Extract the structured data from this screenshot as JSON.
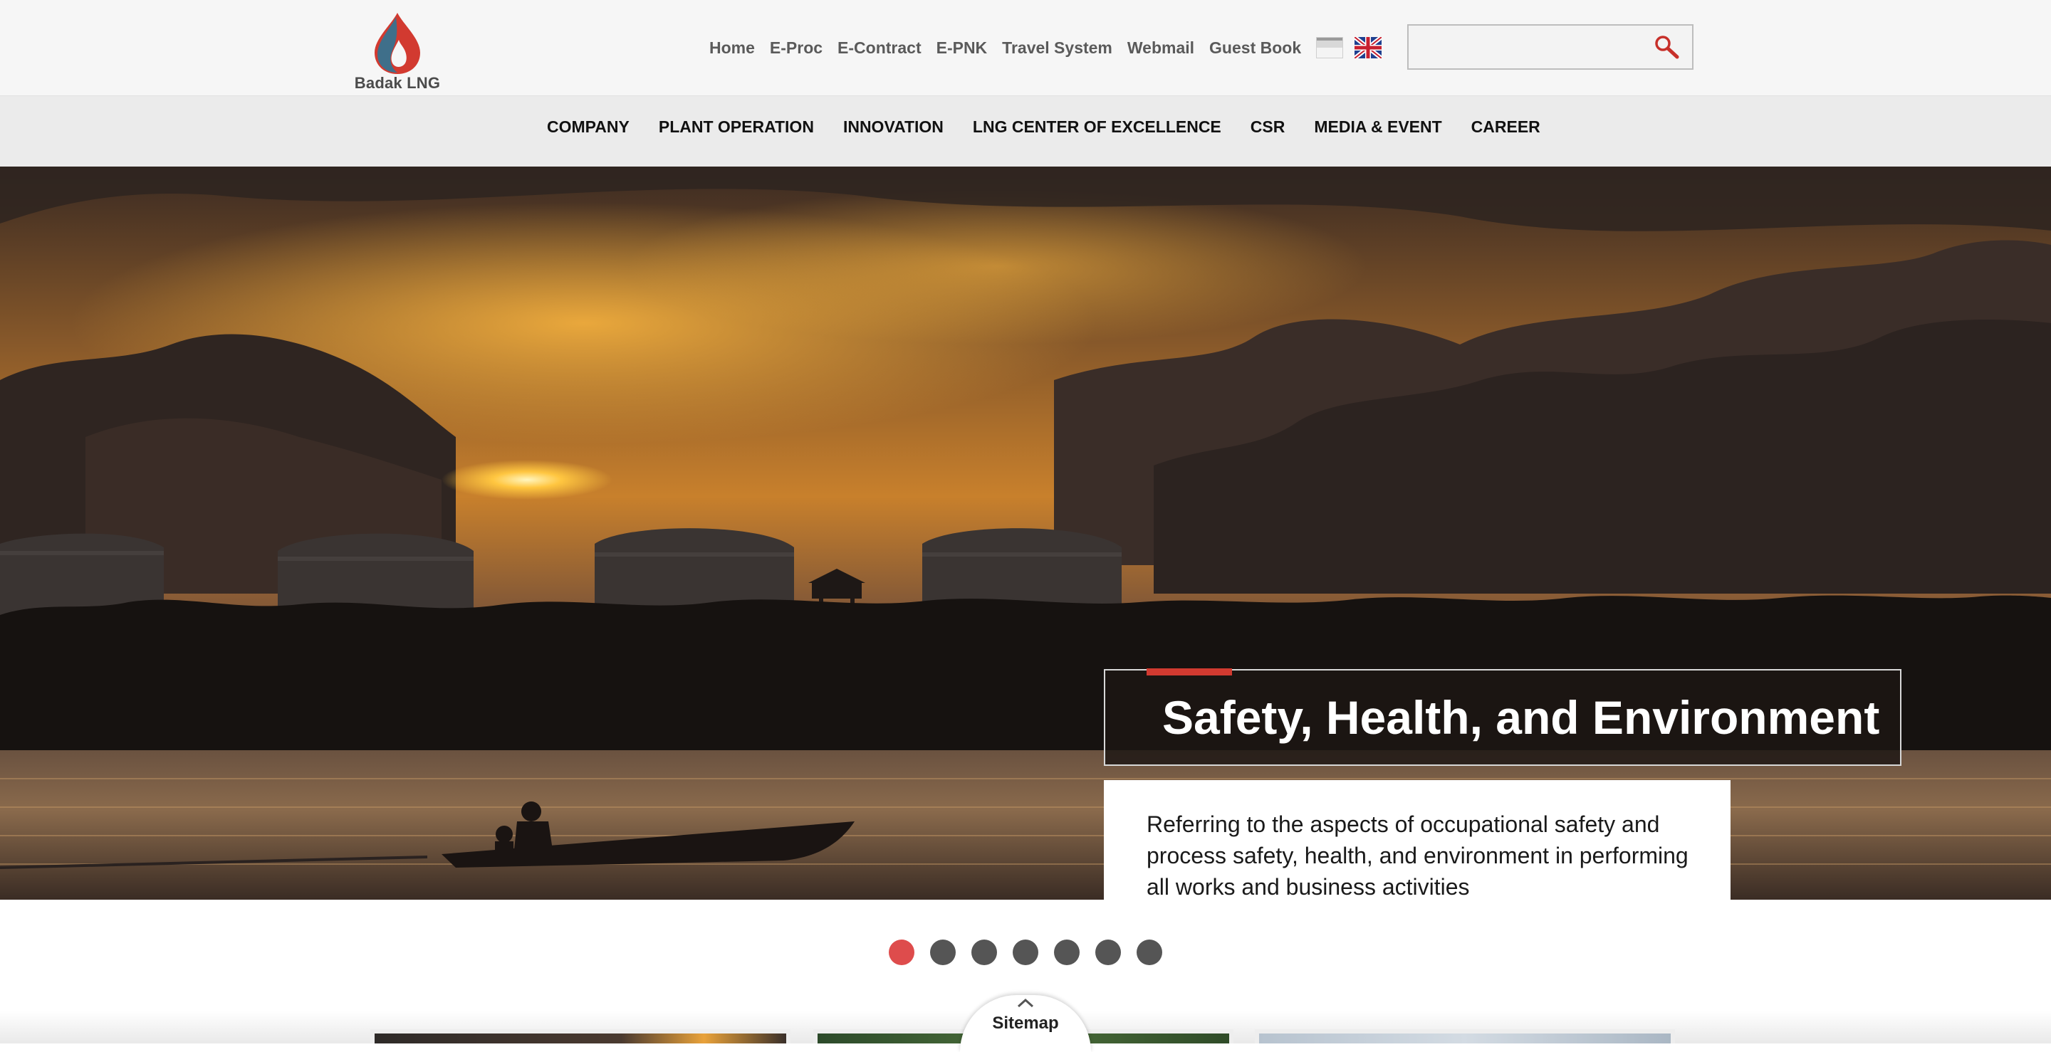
{
  "brand": {
    "logo_text": "Badak LNG",
    "colors": {
      "drop_blue": "#3f6f8a",
      "drop_red": "#d23a30",
      "accent_red": "#d23a30",
      "dot_active": "#de4c4c",
      "dot_inactive": "#555555"
    }
  },
  "utility_nav": [
    {
      "label": "Home"
    },
    {
      "label": "E-Proc"
    },
    {
      "label": "E-Contract"
    },
    {
      "label": "E-PNK"
    },
    {
      "label": "Travel System"
    },
    {
      "label": "Webmail"
    },
    {
      "label": "Guest Book"
    }
  ],
  "languages": [
    {
      "icon": "indonesia-flag-icon"
    },
    {
      "icon": "uk-flag-icon"
    }
  ],
  "search": {
    "value": "",
    "placeholder": "",
    "icon": "search-icon"
  },
  "main_nav": [
    {
      "label": "COMPANY"
    },
    {
      "label": "PLANT OPERATION"
    },
    {
      "label": "INNOVATION"
    },
    {
      "label": "LNG CENTER OF EXCELLENCE"
    },
    {
      "label": "CSR"
    },
    {
      "label": "MEDIA & EVENT"
    },
    {
      "label": "CAREER"
    }
  ],
  "hero": {
    "title": "Safety, Health, and Environment",
    "description": "Referring to the aspects of occupational safety and process safety, health, and environment in performing all works and business activities"
  },
  "slider": {
    "total": 7,
    "active_index": 0
  },
  "sitemap": {
    "label": "Sitemap",
    "icon": "chevron-up-icon"
  }
}
